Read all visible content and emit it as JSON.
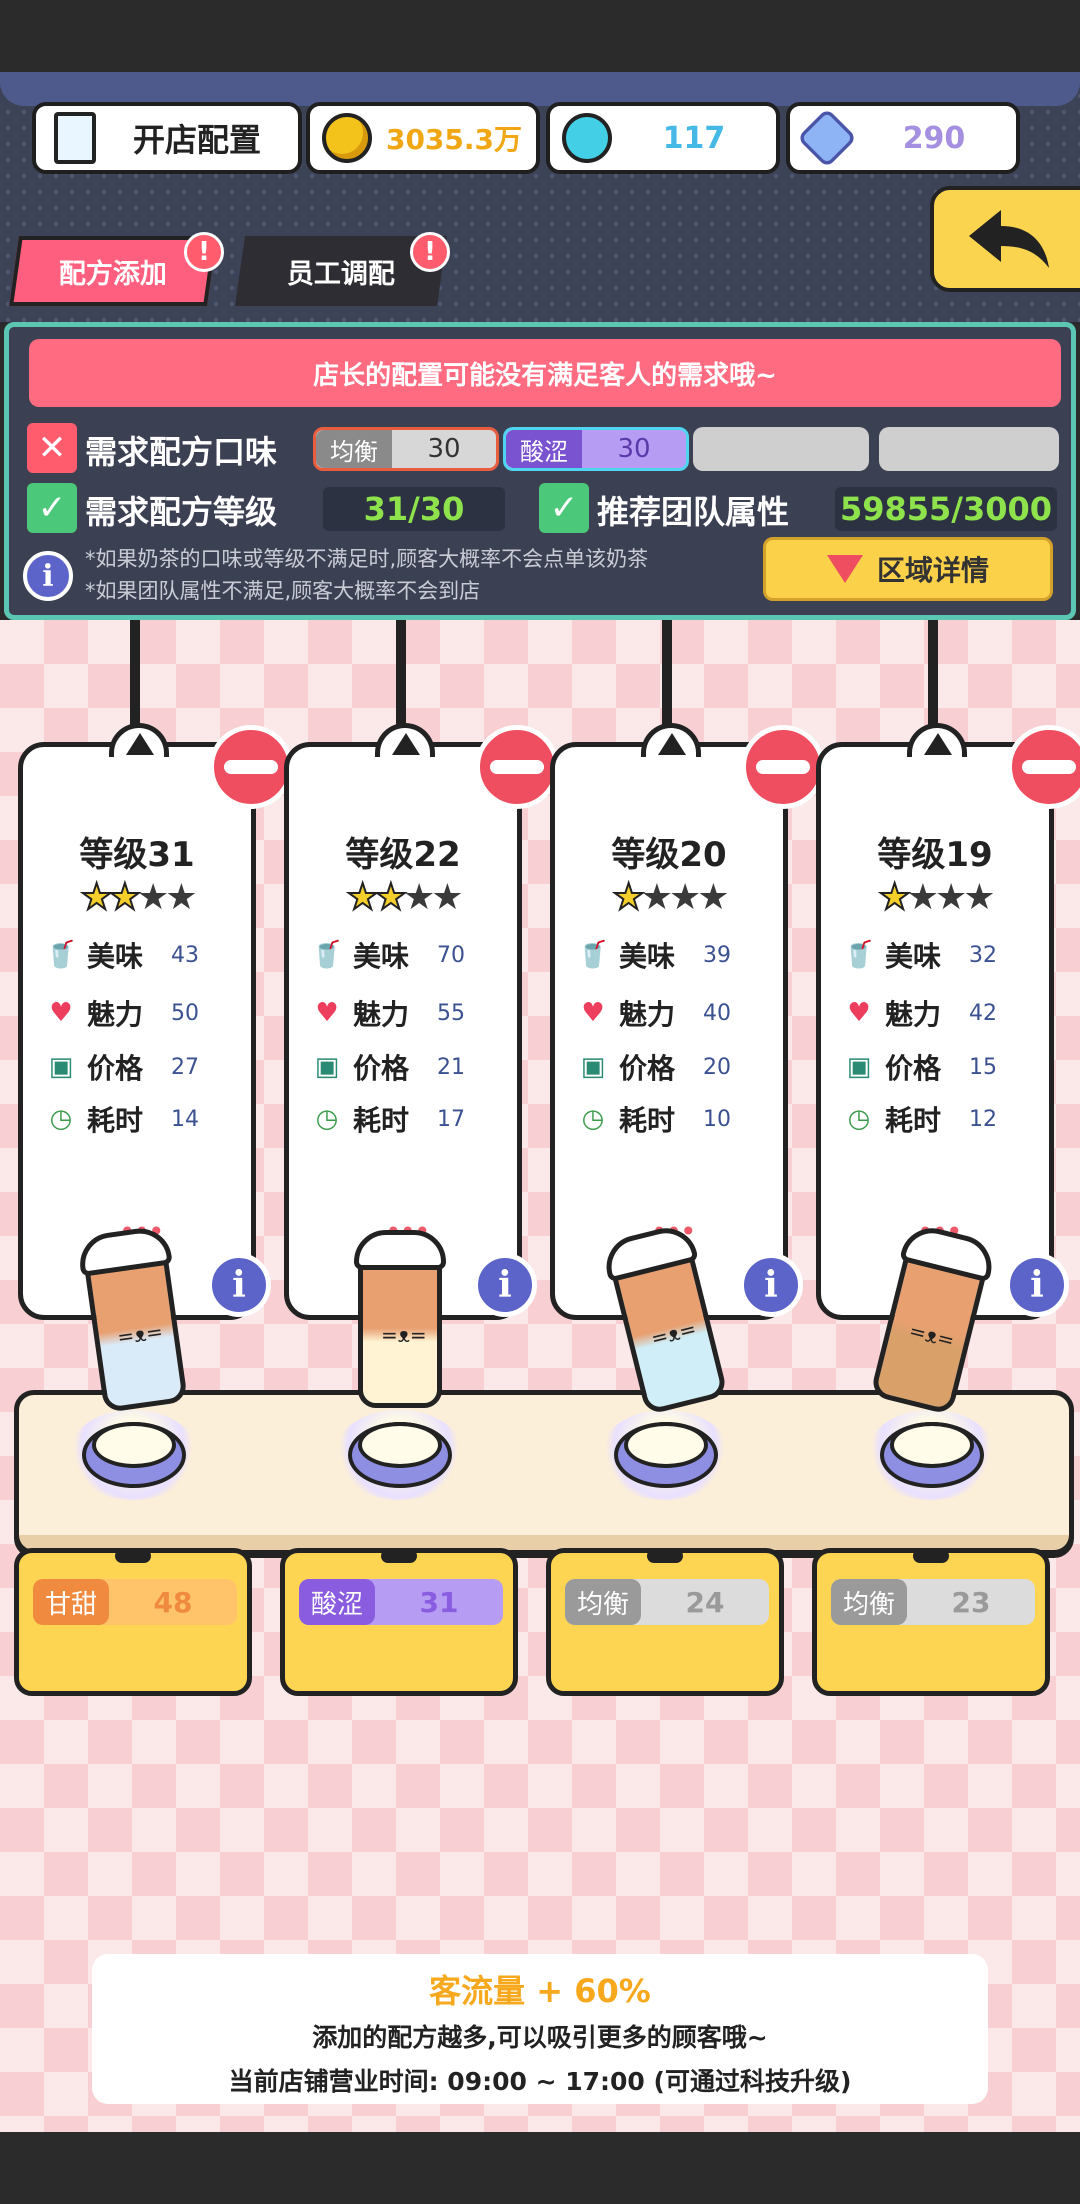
{
  "top_bar": {
    "config_label": "开店配置",
    "gold": "3035.3万",
    "potion": "117",
    "gems": "290"
  },
  "tabs": [
    {
      "label": "配方添加",
      "alert": "!"
    },
    {
      "label": "员工调配",
      "alert": "!"
    }
  ],
  "panel": {
    "warning": "店长的配置可能没有满足客人的需求哦~",
    "flavor_req_label": "需求配方口味",
    "flavor_req_status": "不满足",
    "flavor_slots": [
      {
        "tag": "均衡",
        "value": "30"
      },
      {
        "tag": "酸涩",
        "value": "30"
      }
    ],
    "level_req_label": "需求配方等级",
    "level_req_status": "满足",
    "level_value": "31/30",
    "team_label": "推荐团队属性",
    "team_status": "满足",
    "team_value": "59855/3000",
    "note1": "*如果奶茶的口味或等级不满足时,顾客大概率不会点单该奶茶",
    "note2": "*如果团队属性不满足,顾客大概率不会到店",
    "region_button": "区域详情"
  },
  "stat_labels": {
    "taste": "美味",
    "charm": "魅力",
    "price": "价格",
    "time": "耗时"
  },
  "recipes": [
    {
      "level": "等级31",
      "stars": 2,
      "taste": "43",
      "charm": "50",
      "price": "27",
      "time": "14",
      "flavor_tag": "甘甜",
      "flavor_value": "48",
      "flavor_color": "#f08a3e",
      "flavor_bg": "#ffc46a",
      "cup_color": "#d9eaf8"
    },
    {
      "level": "等级22",
      "stars": 2,
      "taste": "70",
      "charm": "55",
      "price": "21",
      "time": "17",
      "flavor_tag": "酸涩",
      "flavor_value": "31",
      "flavor_color": "#8a5ce0",
      "flavor_bg": "#b79cf4",
      "cup_color": "#fff3d4"
    },
    {
      "level": "等级20",
      "stars": 1,
      "taste": "39",
      "charm": "40",
      "price": "20",
      "time": "10",
      "flavor_tag": "均衡",
      "flavor_value": "24",
      "flavor_color": "#9a9a9a",
      "flavor_bg": "#dcdcdc",
      "cup_color": "#cfeef8"
    },
    {
      "level": "等级19",
      "stars": 1,
      "taste": "32",
      "charm": "42",
      "price": "15",
      "time": "12",
      "flavor_tag": "均衡",
      "flavor_value": "23",
      "flavor_color": "#9a9a9a",
      "flavor_bg": "#dcdcdc",
      "cup_color": "#d9a06a"
    }
  ],
  "footer": {
    "traffic": "客流量 + 60%",
    "line1": "添加的配方越多,可以吸引更多的顾客哦~",
    "line2": "当前店铺营业时间: 09:00 ~ 17:00 (可通过科技升级)"
  },
  "colors": {
    "accent_pink": "#ff6b81",
    "accent_yellow": "#fcd14a",
    "panel_bg": "#3b4153",
    "ok_green": "#8ee34c"
  }
}
